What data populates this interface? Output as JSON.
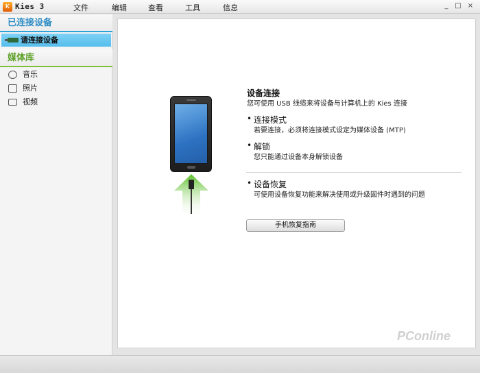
{
  "window": {
    "logo_text": "K",
    "title": "Kies 3",
    "menu": [
      "文件",
      "编辑",
      "查看",
      "工具",
      "信息"
    ],
    "controls": {
      "minimize": "_",
      "maximize": "□",
      "close": "×"
    }
  },
  "sidebar": {
    "connected_header": "已连接设备",
    "device_label": "请连接设备",
    "library_header": "媒体库",
    "library_items": [
      {
        "label": "音乐",
        "icon": "music-icon"
      },
      {
        "label": "照片",
        "icon": "photo-icon"
      },
      {
        "label": "视频",
        "icon": "video-icon"
      }
    ]
  },
  "main": {
    "title": "设备连接",
    "subtitle": "您可使用 USB 线缆来将设备与计算机上的 Kies 连接",
    "sections": [
      {
        "bullet": "•",
        "heading": "连接模式",
        "text": "若要连接，必须将连接模式设定为媒体设备 (MTP)"
      },
      {
        "bullet": "•",
        "heading": "解锁",
        "text": "您只能通过设备本身解锁设备"
      },
      {
        "bullet": "•",
        "heading": "设备恢复",
        "text": "可使用设备恢复功能来解决使用或升级固件时遇到的问题"
      }
    ],
    "guide_button": "手机恢复指南"
  },
  "watermark": "PConline",
  "colors": {
    "connected_accent": "#29a3d8",
    "library_accent": "#7cbf3a",
    "selected_row": "#55bdeb",
    "arrow_green": "#5bbf28"
  }
}
